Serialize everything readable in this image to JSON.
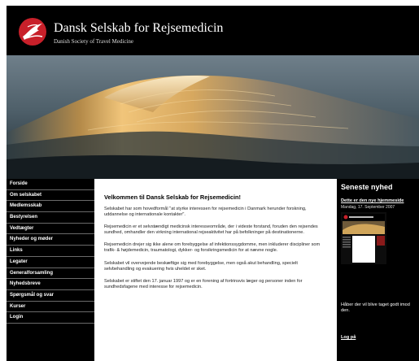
{
  "header": {
    "title": "Dansk Selskab for Rejsemedicin",
    "subtitle": "Danish Society of Travel Medicine",
    "logo_icon": "red-bird-logo-icon"
  },
  "banner": {
    "image": "ocean-wave-photo"
  },
  "nav": {
    "items": [
      "Forside",
      "Om selskabet",
      "Medlemsskab",
      "Bestyrelsen",
      "Vedtægter",
      "Nyheder og møder",
      "Links",
      "Legater",
      "Generalforsamling",
      "Nyhedsbreve",
      "Spørgsmål og svar",
      "Kurser",
      "Login"
    ]
  },
  "main": {
    "title": "Velkommen til Dansk Selskab for Rejsemedicin!",
    "paragraphs": [
      "Selskabet har som hovedformål \"at styrke interessen for rejsemedicin i Danmark herunder forskning, uddannelse og internationale kontakter\".",
      "Rejsemedicin er et selvstændigt medicinsk interesseområde, der i videste forstand, foruden den rejsendes sundhed, omhandler den virkning international rejseaktivitet har på befolkninger på destinationerne.",
      "Rejsemedicin drejer sig ikke alene om forebyggelse af infektionssygdomme, men inkluderer discipliner som trafik- & højdemedicin, traumatologi, dykker- og forsikringsmedicin for at nævne nogle.",
      "Selskabet vil overvejende beskæftige sig med forebyggelse, men også akut behandling, specielt selvbehandling og evakuering hvis uheldet er sket.",
      "Selskabet er stiftet den 17. januar 1997 og er en forening af fortrinsvis læger og personer inden for sundhedsfagene med interesse for rejsemedicin."
    ]
  },
  "news": {
    "heading": "Seneste nyhed",
    "link": "Dette er den nye hjemmeside",
    "date": "Mandag, 17. September 2007",
    "thumbnail": "website-screenshot-thumbnail",
    "text": "Håber der vil blive taget godt imod den.",
    "logout": "Log på"
  },
  "colors": {
    "background": "#000000",
    "content_background": "#ffffff",
    "logo_red": "#c8202a",
    "nav_divider": "#6a6a6a"
  }
}
